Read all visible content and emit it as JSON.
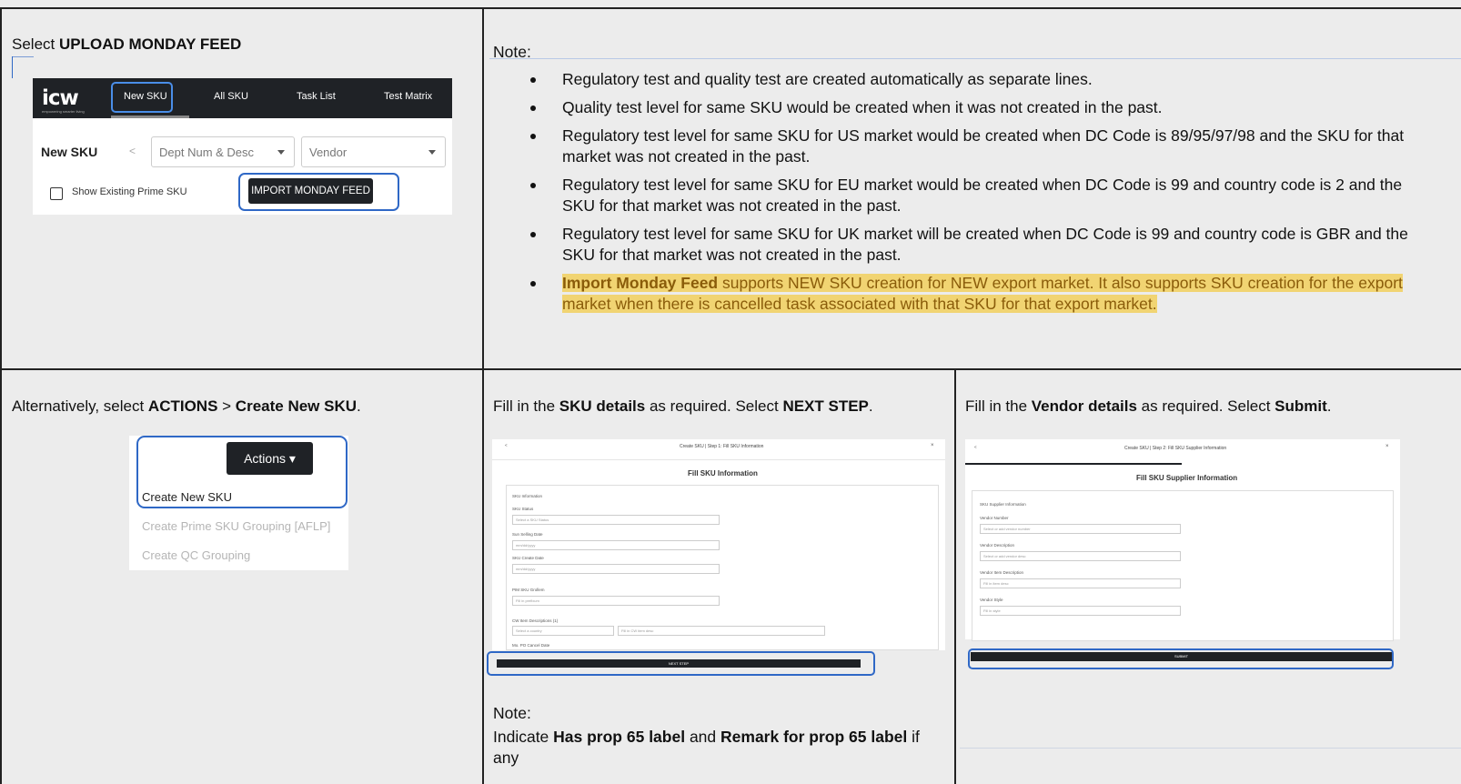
{
  "cell1": {
    "prefix": "Select ",
    "bold": "UPLOAD MONDAY FEED"
  },
  "shot1": {
    "logo": "icw",
    "logo_sub": "empowering smarter living",
    "tabs": [
      "New SKU",
      "All SKU",
      "Task List",
      "Test Matrix"
    ],
    "page_label": "New SKU",
    "chevron": "<",
    "dept_placeholder": "Dept Num & Desc",
    "vendor_placeholder": "Vendor",
    "checkbox_label": "Show Existing Prime SKU",
    "import_button": "IMPORT MONDAY FEED"
  },
  "notes": {
    "heading": "Note:",
    "items": [
      "Regulatory test and quality test are created automatically as separate lines.",
      "Quality test level for same SKU would be created when it was not created in the past.",
      "Regulatory test level for same SKU for US market would be created when DC Code is 89/95/97/98 and the SKU for that market was not created in the past.",
      "Regulatory test level for same SKU for EU market would be created when DC Code is 99 and country code is 2 and the SKU for that market was not created in the past.",
      "Regulatory test level for same SKU for UK market will be created when DC Code is 99 and country code is GBR and the SKU for that market was not created in the past."
    ],
    "highlight_bold": "Import Monday Feed",
    "highlight_rest": " supports NEW SKU creation for NEW export market. It also supports SKU creation for the export market when there is cancelled task associated with that SKU for that export market."
  },
  "cell3": {
    "prefix": "Alternatively, select ",
    "b1": "ACTIONS",
    "mid": " > ",
    "b2": "Create New SKU",
    "suffix": "."
  },
  "shot2": {
    "actions_button": "Actions ▾",
    "menu": [
      "Create New SKU",
      "Create Prime SKU Grouping [AFLP]",
      "Create QC Grouping"
    ]
  },
  "cell4": {
    "prefix": "Fill in the ",
    "b1": "SKU details",
    "mid": " as required. Select ",
    "b2": "NEXT STEP",
    "suffix": "."
  },
  "shot3": {
    "header": "Create SKU  |  Step 1: Fill SKU Information",
    "back": "<",
    "close": "×",
    "title": "Fill SKU Information",
    "section": "SKU Information",
    "fields": [
      {
        "label": "SKU Status",
        "placeholder": "Select a SKU Status"
      },
      {
        "label": "Sun Selling Date",
        "placeholder": "mm/dd/yyyy"
      },
      {
        "label": "SKU Create Date",
        "placeholder": "mm/dd/yyyy"
      },
      {
        "label": "PIM SKU Grollem",
        "placeholder": "Fill in prefixum"
      }
    ],
    "extra_label": "CW Item Descriptions (1)",
    "country_placeholder": "Select a country",
    "desc_placeholder": "Fill in CW item desc",
    "last_label": "Mo. PO Cancel Date",
    "next_button": "NEXT STEP"
  },
  "cell5": {
    "prefix": "Fill in the ",
    "b1": "Vendor details",
    "mid": " as required. Select ",
    "b2": "Submit",
    "suffix": "."
  },
  "shot4": {
    "header": "Create SKU  |  Step 2: Fill SKU Supplier Information",
    "back": "<",
    "close": "×",
    "title": "Fill SKU Supplier Information",
    "section": "SKU Supplier Information",
    "fields": [
      {
        "label": "Vendor Number",
        "placeholder": "Select or add vendor number"
      },
      {
        "label": "Vendor Description",
        "placeholder": "Select or add vendor desc"
      },
      {
        "label": "Vendor Item Description",
        "placeholder": "Fill in item desc"
      },
      {
        "label": "Vendor Style",
        "placeholder": "Fill in style"
      }
    ],
    "submit_button": "SUBMIT"
  },
  "note2": {
    "heading": "Note:",
    "prefix": "Indicate ",
    "b1": "Has prop 65 label",
    "mid": " and ",
    "b2": "Remark for prop 65 label",
    "suffix": " if any"
  }
}
